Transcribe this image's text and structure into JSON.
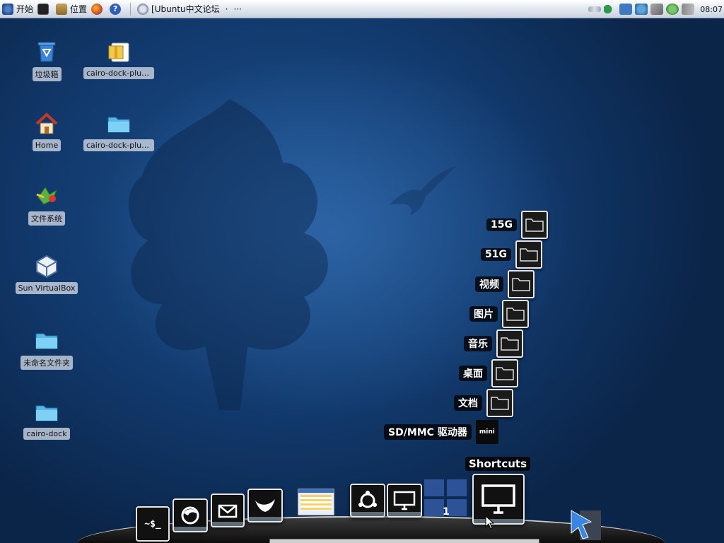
{
  "top_panel": {
    "apps_label": "开始",
    "places_label": "位置",
    "window_title": "[Ubuntu中文论坛",
    "window_dot": "·",
    "more": "···",
    "clock": "08:07"
  },
  "desktop": {
    "icons": [
      {
        "label": "垃圾箱",
        "icon": "trash-icon"
      },
      {
        "label": "Home",
        "icon": "home-icon"
      },
      {
        "label": "文件系统",
        "icon": "filesystem-icon"
      },
      {
        "label": "Sun VirtualBox",
        "icon": "virtualbox-icon"
      },
      {
        "label": "未命名文件夹",
        "icon": "folder-icon"
      },
      {
        "label": "cairo-dock",
        "icon": "folder-icon"
      },
      {
        "label": "cairo-dock-plug···",
        "icon": "package-icon"
      },
      {
        "label": "cairo-dock-plug···",
        "icon": "folder-icon"
      }
    ]
  },
  "shortcuts_stack": {
    "items": [
      {
        "label": "15G"
      },
      {
        "label": "51G"
      },
      {
        "label": "视频"
      },
      {
        "label": "图片"
      },
      {
        "label": "音乐"
      },
      {
        "label": "桌面"
      },
      {
        "label": "文档"
      },
      {
        "label": "SD/MMC 驱动器"
      }
    ]
  },
  "dock": {
    "terminal_text": "~$_",
    "workspace_number": "1",
    "tooltip": "Shortcuts",
    "launchers": [
      "terminal-icon",
      "firefox-icon",
      "mail-icon",
      "gimp-icon",
      "window-thumbnail",
      "ubuntu-icon",
      "monitor-icon",
      "workspace-switcher",
      "shortcuts-icon",
      "cursor-3d-icon"
    ]
  },
  "colors": {
    "desktop_bg": "#1c4f8c",
    "panel_bg": "#dfe5ee",
    "label_bg": "#c8d2e1"
  }
}
